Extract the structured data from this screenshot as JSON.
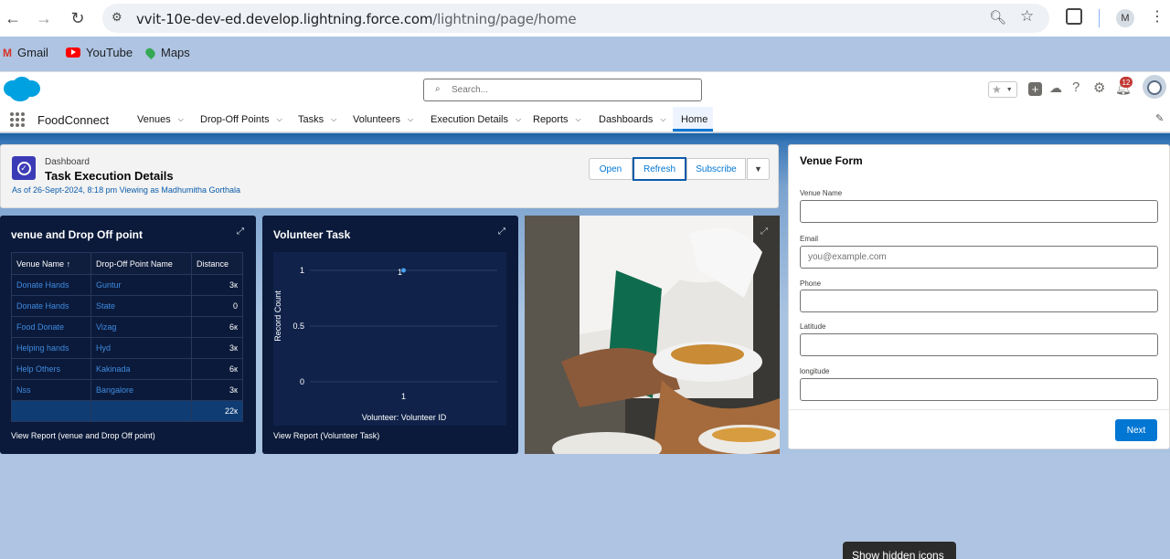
{
  "browser": {
    "url_host": "vvit-10e-dev-ed.develop.lightning.force.com",
    "url_path": "/lightning/page/home",
    "profile_initial": "M"
  },
  "bookmarks": [
    {
      "label": "Gmail",
      "icon": "gmail-icon"
    },
    {
      "label": "YouTube",
      "icon": "youtube-icon"
    },
    {
      "label": "Maps",
      "icon": "maps-icon"
    }
  ],
  "sf": {
    "search_placeholder": "Search...",
    "notification_count": "12",
    "app_name": "FoodConnect",
    "nav": [
      {
        "label": "Venues"
      },
      {
        "label": "Drop-Off Points"
      },
      {
        "label": "Tasks"
      },
      {
        "label": "Volunteers"
      },
      {
        "label": "Execution Details"
      },
      {
        "label": "Reports"
      },
      {
        "label": "Dashboards"
      },
      {
        "label": "Home"
      }
    ]
  },
  "dashboard": {
    "type_label": "Dashboard",
    "title": "Task Execution Details",
    "meta": "As of 26-Sept-2024, 8:18 pm Viewing as Madhumitha Gorthala",
    "buttons": {
      "open": "Open",
      "refresh": "Refresh",
      "subscribe": "Subscribe"
    }
  },
  "widget_table": {
    "title": "venue and Drop Off point",
    "headers": [
      "Venue Name",
      "Drop-Off Point Name",
      "Distance"
    ],
    "sort_indicator": "↑",
    "rows": [
      [
        "Donate Hands",
        "Guntur",
        "3к"
      ],
      [
        "Donate Hands",
        "State",
        "0"
      ],
      [
        "Food Donate",
        "Vizag",
        "6к"
      ],
      [
        "Helping hands",
        "Hyd",
        "3к"
      ],
      [
        "Help Others",
        "Kakinada",
        "6к"
      ],
      [
        "Nss",
        "Bangalore",
        "3к"
      ]
    ],
    "total": "22к",
    "view_report": "View Report (venue and Drop Off point)"
  },
  "widget_chart": {
    "title": "Volunteer Task",
    "view_report": "View Report (Volunteer Task)"
  },
  "chart_data": {
    "type": "scatter",
    "title": "Volunteer Task",
    "xlabel": "Volunteer: Volunteer ID",
    "ylabel": "Record Count",
    "x": [
      "1"
    ],
    "values": [
      1
    ],
    "ylim": [
      0,
      1
    ],
    "y_ticks": [
      "1",
      "0.5",
      "0"
    ],
    "data_labels": [
      "1"
    ],
    "grid": true,
    "colors": {
      "point": "#4aa0f0",
      "background": "#0b1a3a"
    }
  },
  "venue_form": {
    "title": "Venue Form",
    "fields": [
      {
        "label": "Venue Name",
        "placeholder": ""
      },
      {
        "label": "Email",
        "placeholder": "you@example.com"
      },
      {
        "label": "Phone",
        "placeholder": ""
      },
      {
        "label": "Latitude",
        "placeholder": ""
      },
      {
        "label": "longitude",
        "placeholder": ""
      }
    ],
    "next_label": "Next"
  },
  "tooltip": "Show hidden icons",
  "colors": {
    "brand": "#0176d3",
    "widget_bg": "#0b1a3a",
    "link": "#3f8be0"
  }
}
